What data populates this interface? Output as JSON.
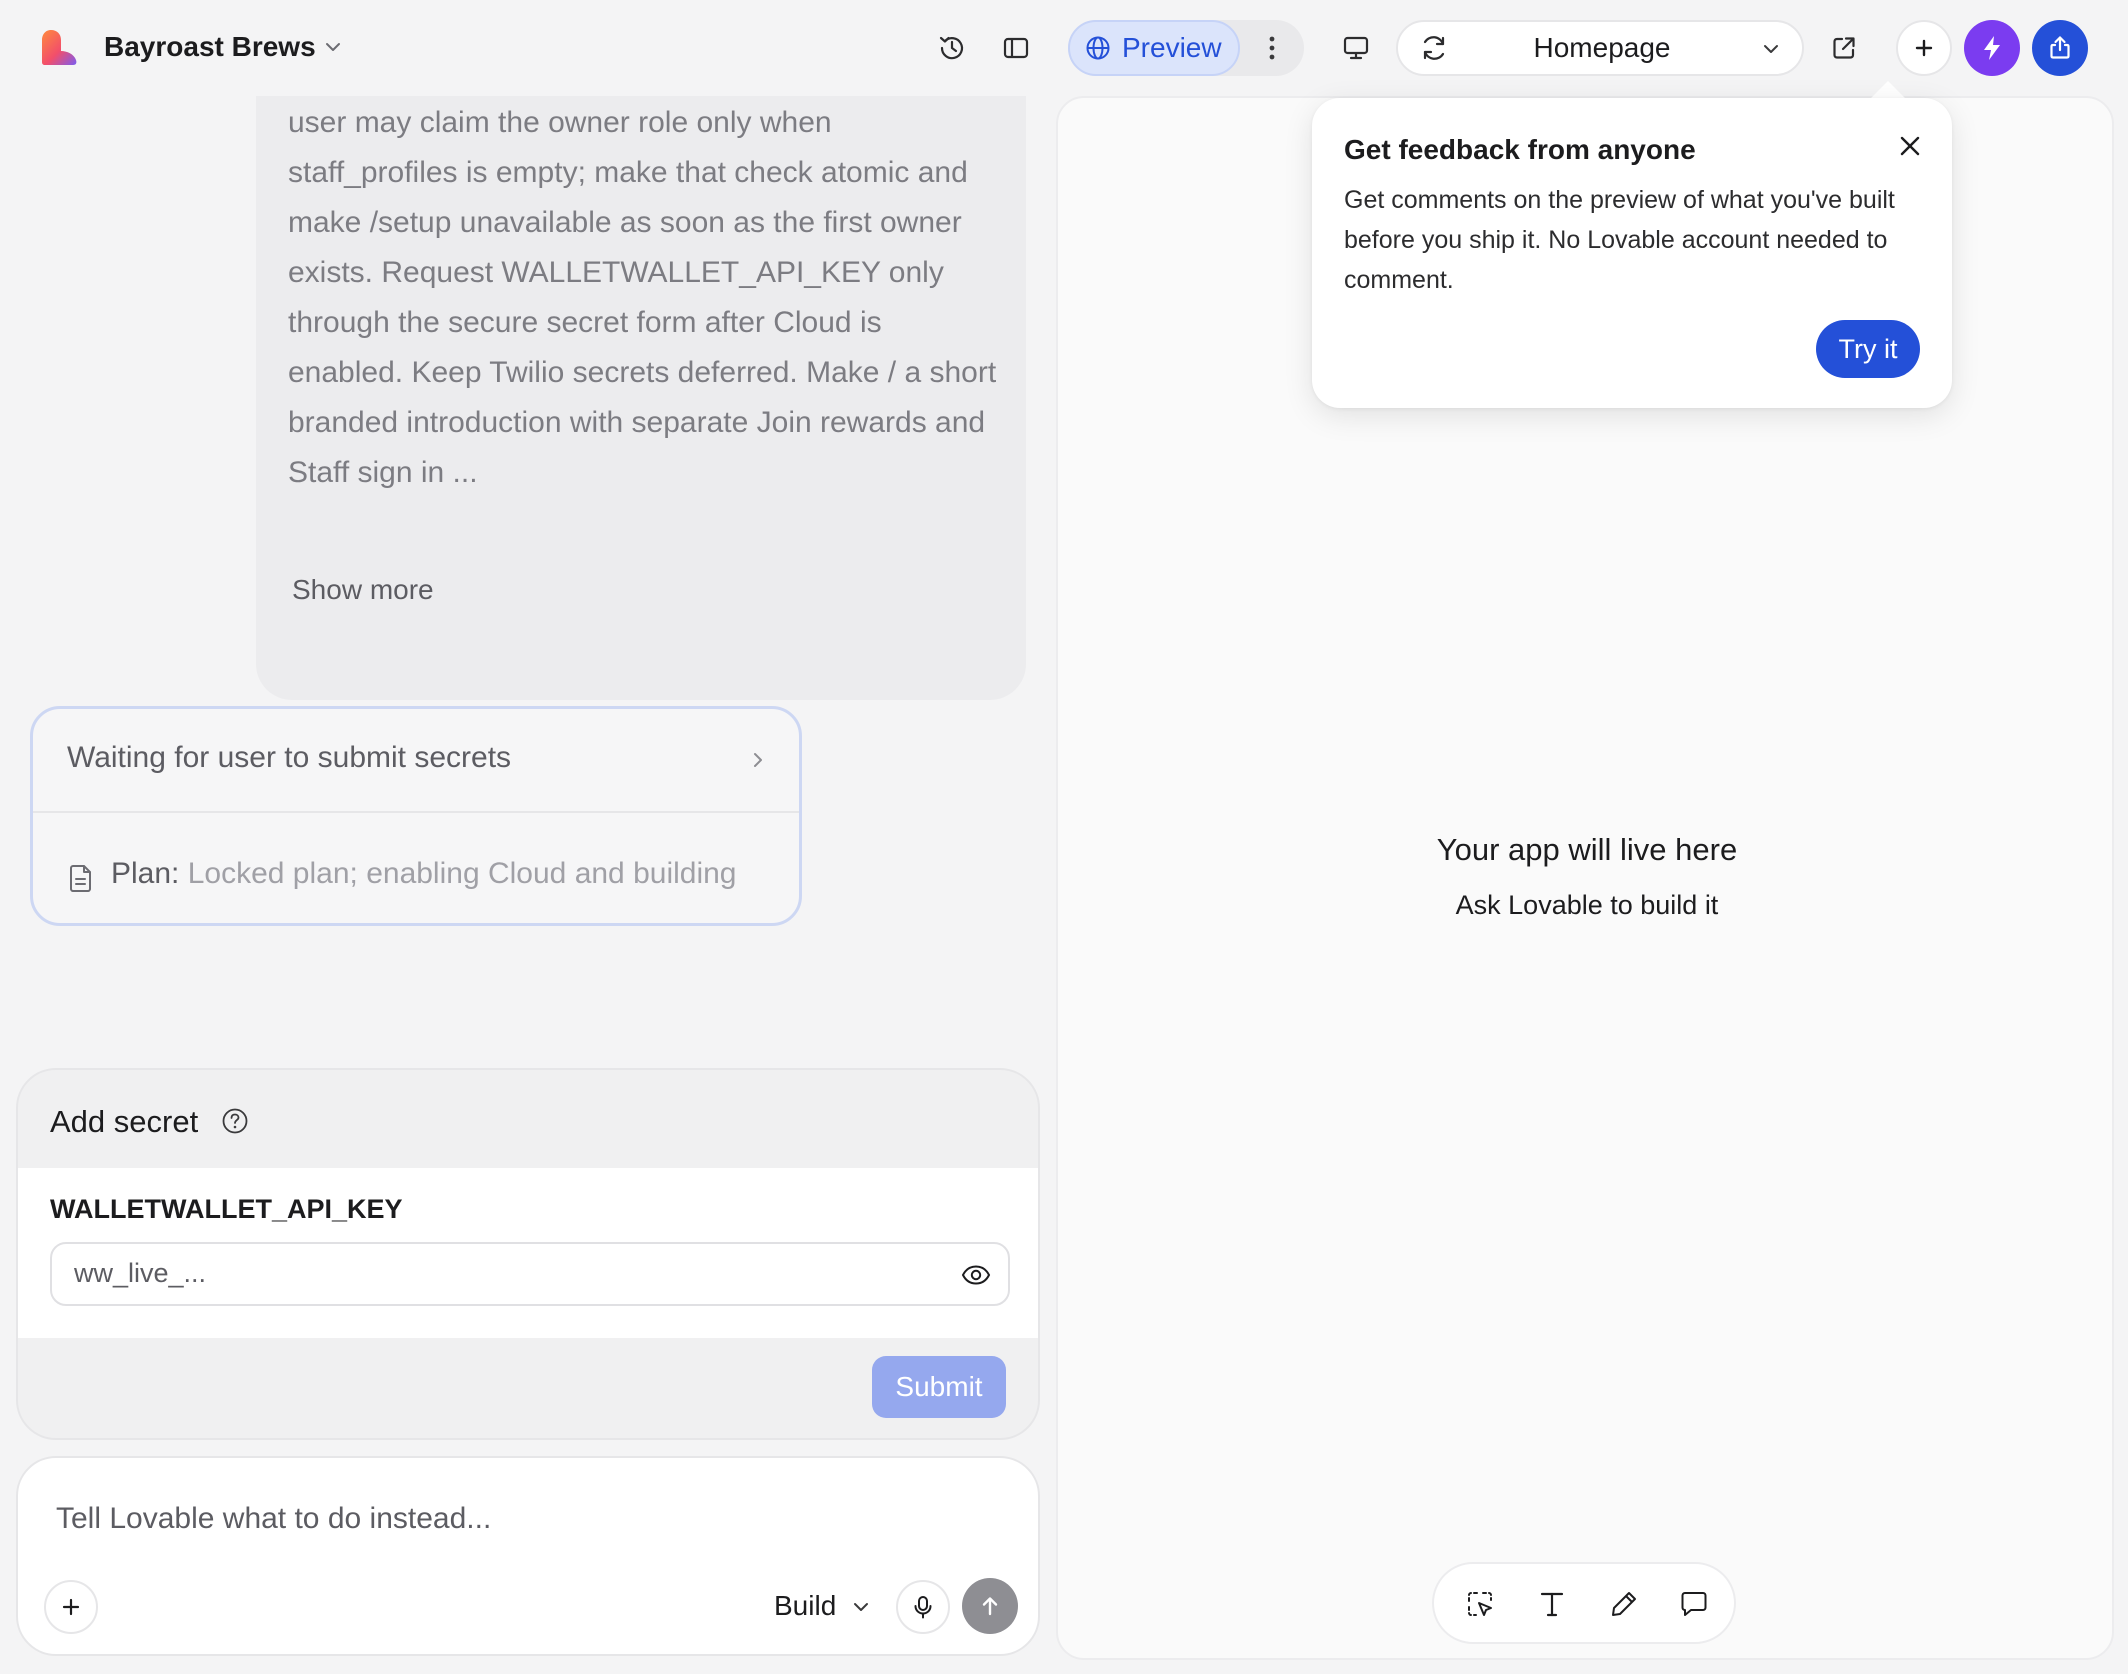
{
  "header": {
    "project_name": "Bayroast Brews",
    "preview_label": "Preview",
    "route": "Homepage"
  },
  "chat": {
    "message_text": "Use a one-time owner bootstrap: an authenticated user may claim the owner role only when staff_profiles is empty; make that check atomic and make /setup unavailable as soon as the first owner exists. Request WALLETWALLET_API_KEY only through the secure secret form after Cloud is enabled. Keep Twilio secrets deferred. Make / a short branded introduction with separate Join rewards and Staff sign in ...",
    "show_more": "Show more",
    "status_title": "Waiting for user to submit secrets",
    "plan_label": "Plan:",
    "plan_value": "Locked plan; enabling Cloud and building"
  },
  "secret_form": {
    "title": "Add secret",
    "key_name": "WALLETWALLET_API_KEY",
    "input_value": "ww_live_...",
    "submit_label": "Submit"
  },
  "composer": {
    "placeholder": "Tell Lovable what to do instead...",
    "mode": "Build"
  },
  "preview": {
    "empty_title": "Your app will live here",
    "empty_subtitle": "Ask Lovable to build it"
  },
  "popover": {
    "title": "Get feedback from anyone",
    "body": "Get comments on the preview of what you've built before you ship it. No Lovable account needed to comment.",
    "cta": "Try it"
  },
  "colors": {
    "accent_blue": "#2450d8",
    "bolt_purple": "#7b3cf0",
    "submit_disabled": "#95a8ee"
  },
  "icons": [
    "logo-icon",
    "chevron-down-icon",
    "history-icon",
    "sidebar-toggle-icon",
    "globe-icon",
    "more-vertical-icon",
    "desktop-icon",
    "refresh-icon",
    "external-link-icon",
    "plus-icon",
    "bolt-icon",
    "share-icon",
    "help-icon",
    "eye-icon",
    "file-icon",
    "microphone-icon",
    "arrow-up-icon",
    "select-element-icon",
    "text-icon",
    "pencil-icon",
    "comment-icon",
    "close-icon"
  ]
}
